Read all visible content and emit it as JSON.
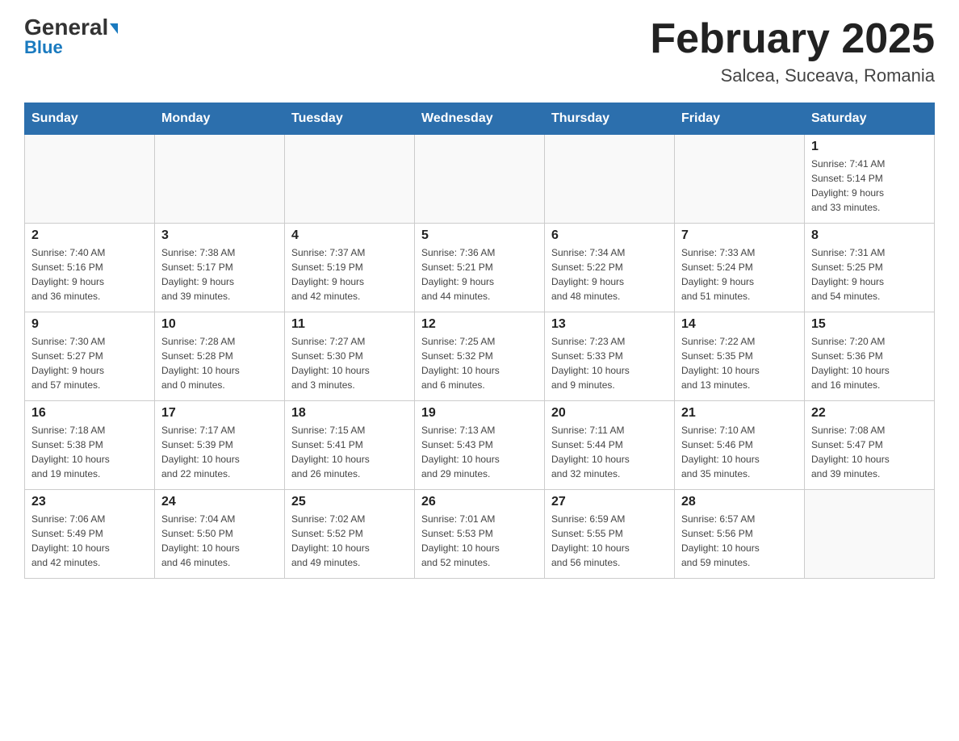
{
  "header": {
    "logo_general": "General",
    "logo_blue": "Blue",
    "month_title": "February 2025",
    "location": "Salcea, Suceava, Romania"
  },
  "weekdays": [
    "Sunday",
    "Monday",
    "Tuesday",
    "Wednesday",
    "Thursday",
    "Friday",
    "Saturday"
  ],
  "weeks": [
    [
      {
        "day": "",
        "info": ""
      },
      {
        "day": "",
        "info": ""
      },
      {
        "day": "",
        "info": ""
      },
      {
        "day": "",
        "info": ""
      },
      {
        "day": "",
        "info": ""
      },
      {
        "day": "",
        "info": ""
      },
      {
        "day": "1",
        "info": "Sunrise: 7:41 AM\nSunset: 5:14 PM\nDaylight: 9 hours\nand 33 minutes."
      }
    ],
    [
      {
        "day": "2",
        "info": "Sunrise: 7:40 AM\nSunset: 5:16 PM\nDaylight: 9 hours\nand 36 minutes."
      },
      {
        "day": "3",
        "info": "Sunrise: 7:38 AM\nSunset: 5:17 PM\nDaylight: 9 hours\nand 39 minutes."
      },
      {
        "day": "4",
        "info": "Sunrise: 7:37 AM\nSunset: 5:19 PM\nDaylight: 9 hours\nand 42 minutes."
      },
      {
        "day": "5",
        "info": "Sunrise: 7:36 AM\nSunset: 5:21 PM\nDaylight: 9 hours\nand 44 minutes."
      },
      {
        "day": "6",
        "info": "Sunrise: 7:34 AM\nSunset: 5:22 PM\nDaylight: 9 hours\nand 48 minutes."
      },
      {
        "day": "7",
        "info": "Sunrise: 7:33 AM\nSunset: 5:24 PM\nDaylight: 9 hours\nand 51 minutes."
      },
      {
        "day": "8",
        "info": "Sunrise: 7:31 AM\nSunset: 5:25 PM\nDaylight: 9 hours\nand 54 minutes."
      }
    ],
    [
      {
        "day": "9",
        "info": "Sunrise: 7:30 AM\nSunset: 5:27 PM\nDaylight: 9 hours\nand 57 minutes."
      },
      {
        "day": "10",
        "info": "Sunrise: 7:28 AM\nSunset: 5:28 PM\nDaylight: 10 hours\nand 0 minutes."
      },
      {
        "day": "11",
        "info": "Sunrise: 7:27 AM\nSunset: 5:30 PM\nDaylight: 10 hours\nand 3 minutes."
      },
      {
        "day": "12",
        "info": "Sunrise: 7:25 AM\nSunset: 5:32 PM\nDaylight: 10 hours\nand 6 minutes."
      },
      {
        "day": "13",
        "info": "Sunrise: 7:23 AM\nSunset: 5:33 PM\nDaylight: 10 hours\nand 9 minutes."
      },
      {
        "day": "14",
        "info": "Sunrise: 7:22 AM\nSunset: 5:35 PM\nDaylight: 10 hours\nand 13 minutes."
      },
      {
        "day": "15",
        "info": "Sunrise: 7:20 AM\nSunset: 5:36 PM\nDaylight: 10 hours\nand 16 minutes."
      }
    ],
    [
      {
        "day": "16",
        "info": "Sunrise: 7:18 AM\nSunset: 5:38 PM\nDaylight: 10 hours\nand 19 minutes."
      },
      {
        "day": "17",
        "info": "Sunrise: 7:17 AM\nSunset: 5:39 PM\nDaylight: 10 hours\nand 22 minutes."
      },
      {
        "day": "18",
        "info": "Sunrise: 7:15 AM\nSunset: 5:41 PM\nDaylight: 10 hours\nand 26 minutes."
      },
      {
        "day": "19",
        "info": "Sunrise: 7:13 AM\nSunset: 5:43 PM\nDaylight: 10 hours\nand 29 minutes."
      },
      {
        "day": "20",
        "info": "Sunrise: 7:11 AM\nSunset: 5:44 PM\nDaylight: 10 hours\nand 32 minutes."
      },
      {
        "day": "21",
        "info": "Sunrise: 7:10 AM\nSunset: 5:46 PM\nDaylight: 10 hours\nand 35 minutes."
      },
      {
        "day": "22",
        "info": "Sunrise: 7:08 AM\nSunset: 5:47 PM\nDaylight: 10 hours\nand 39 minutes."
      }
    ],
    [
      {
        "day": "23",
        "info": "Sunrise: 7:06 AM\nSunset: 5:49 PM\nDaylight: 10 hours\nand 42 minutes."
      },
      {
        "day": "24",
        "info": "Sunrise: 7:04 AM\nSunset: 5:50 PM\nDaylight: 10 hours\nand 46 minutes."
      },
      {
        "day": "25",
        "info": "Sunrise: 7:02 AM\nSunset: 5:52 PM\nDaylight: 10 hours\nand 49 minutes."
      },
      {
        "day": "26",
        "info": "Sunrise: 7:01 AM\nSunset: 5:53 PM\nDaylight: 10 hours\nand 52 minutes."
      },
      {
        "day": "27",
        "info": "Sunrise: 6:59 AM\nSunset: 5:55 PM\nDaylight: 10 hours\nand 56 minutes."
      },
      {
        "day": "28",
        "info": "Sunrise: 6:57 AM\nSunset: 5:56 PM\nDaylight: 10 hours\nand 59 minutes."
      },
      {
        "day": "",
        "info": ""
      }
    ]
  ]
}
